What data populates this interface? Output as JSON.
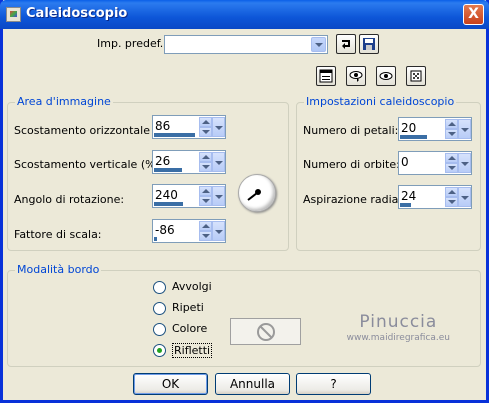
{
  "window": {
    "title": "Caleidoscopio",
    "close_label": "X"
  },
  "preset": {
    "label": "Imp. predef.:",
    "value": ""
  },
  "area_immagine": {
    "title": "Area d'immagine",
    "fields": [
      {
        "label": "Scostamento orizzontale (%):",
        "value": "86",
        "fill": 0.93
      },
      {
        "label": "Scostamento verticale (%):",
        "value": "26",
        "fill": 0.63
      },
      {
        "label": "Angolo di rotazione:",
        "value": "240",
        "fill": 0.67
      },
      {
        "label": "Fattore di scala:",
        "value": "-86",
        "fill": 0.07
      }
    ]
  },
  "impostazioni": {
    "title": "Impostazioni caleidoscopio",
    "fields": [
      {
        "label": "Numero di petali:",
        "value": "20",
        "fill": 0.62
      },
      {
        "label": "Numero di orbite:",
        "value": "0",
        "fill": 0.0
      },
      {
        "label": "Aspirazione radiale:",
        "value": "24",
        "fill": 0.24
      }
    ]
  },
  "modalita_bordo": {
    "title": "Modalità bordo",
    "options": [
      {
        "label": "Avvolgi",
        "checked": false
      },
      {
        "label": "Ripeti",
        "checked": false
      },
      {
        "label": "Colore",
        "checked": false
      },
      {
        "label": "Rifletti",
        "checked": true
      }
    ]
  },
  "buttons": {
    "ok": "OK",
    "cancel": "Annulla",
    "help": "?"
  },
  "watermark": {
    "name": "Pinuccia",
    "url": "www.maidiregrafica.eu"
  },
  "icons": {
    "toolbar": [
      "save-preset-icon",
      "random-icon",
      "reset-icon",
      "dice-icon"
    ],
    "color_swatch": "no-entry-icon"
  },
  "colors": {
    "titlebar": "#0A5FE8",
    "accent": "#0046D5",
    "value_bar": "#3A6EA5"
  }
}
